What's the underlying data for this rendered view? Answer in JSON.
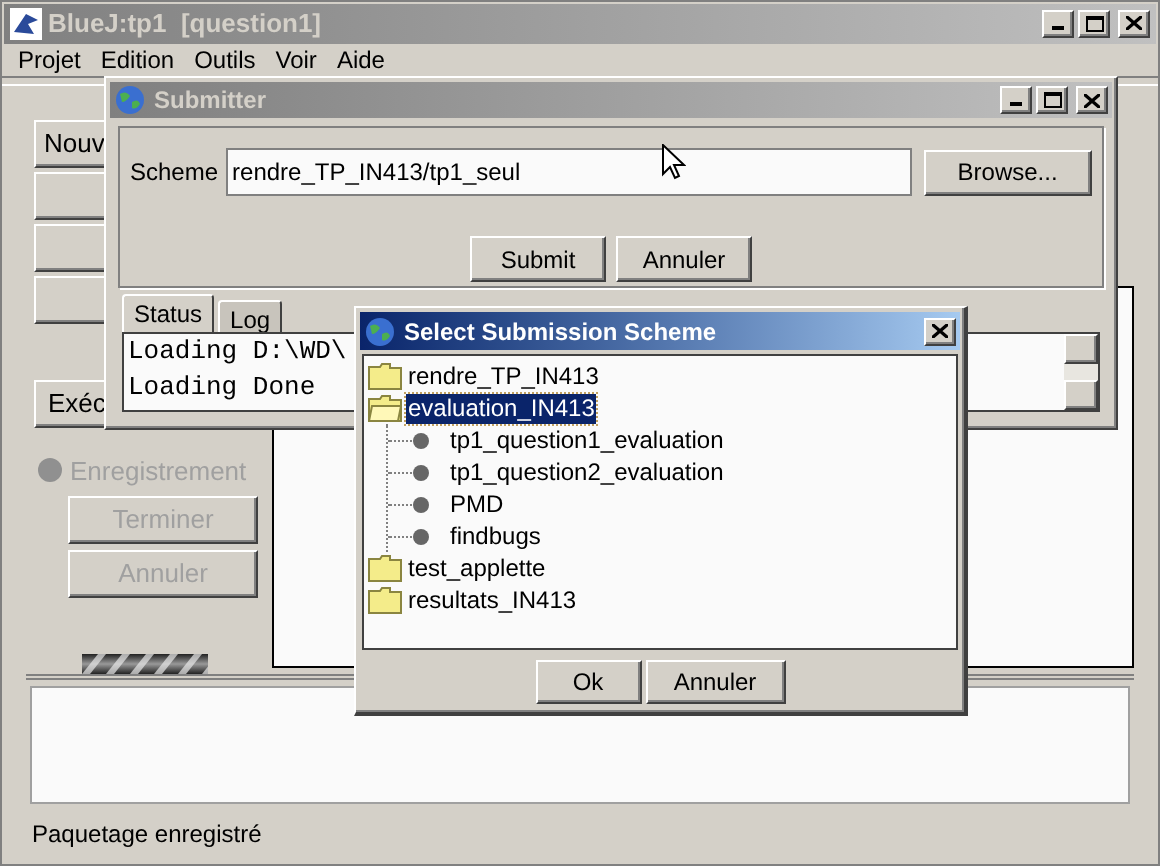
{
  "main_window": {
    "title": "BlueJ:tp1  [question1]",
    "menu": [
      "Projet",
      "Edition",
      "Outils",
      "Voir",
      "Aide"
    ],
    "side_buttons": [
      {
        "kind": "labelled",
        "label": "Nouv"
      },
      {
        "kind": "blank"
      },
      {
        "kind": "blank"
      },
      {
        "kind": "blank"
      }
    ],
    "run_button": "Exéc",
    "recording": {
      "label": "Enregistrement",
      "disabled": true
    },
    "recording_buttons": [
      {
        "label": "Terminer",
        "disabled": true
      },
      {
        "label": "Annuler",
        "disabled": true
      }
    ],
    "status_bar": "Paquetage enregistré"
  },
  "submitter": {
    "title": "Submitter",
    "scheme_label": "Scheme",
    "scheme_value": "rendre_TP_IN413/tp1_seul",
    "browse": "Browse...",
    "buttons": [
      "Submit",
      "Annuler"
    ],
    "tabs": [
      {
        "label": "Status",
        "selected": true
      },
      {
        "label": "Log",
        "selected": false
      }
    ],
    "log_lines": [
      "Loading D:\\WD\\",
      "Loading Done"
    ]
  },
  "dialog": {
    "title": "Select Submission Scheme",
    "tree": [
      {
        "label": "rendre_TP_IN413",
        "expanded": false,
        "selected": false
      },
      {
        "label": "evaluation_IN413",
        "expanded": true,
        "selected": true,
        "children": [
          {
            "label": "tp1_question1_evaluation",
            "selected": false
          },
          {
            "label": "tp1_question2_evaluation",
            "selected": false
          },
          {
            "label": "PMD",
            "selected": false
          },
          {
            "label": "findbugs",
            "selected": false
          }
        ]
      },
      {
        "label": "test_applette",
        "expanded": false,
        "selected": false
      },
      {
        "label": "resultats_IN413",
        "expanded": false,
        "selected": false
      }
    ],
    "buttons": [
      "Ok",
      "Annuler"
    ]
  }
}
